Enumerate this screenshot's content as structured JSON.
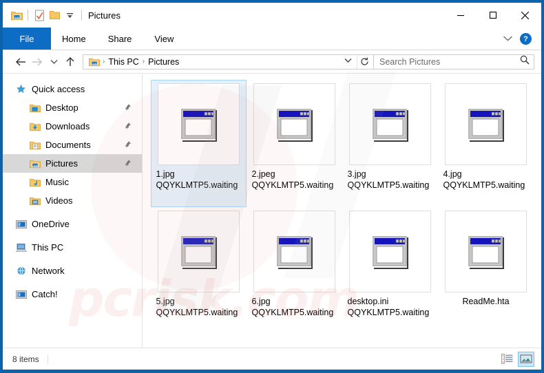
{
  "window": {
    "title": "Pictures",
    "accent_color": "#0b63ac",
    "quick_access": [
      {
        "name": "pictures-folder-icon",
        "label": "Pictures"
      },
      {
        "name": "properties-icon",
        "label": "Properties"
      },
      {
        "name": "new-folder-icon",
        "label": "New folder"
      },
      {
        "name": "customize-chevron-icon",
        "label": "Customize Quick Access Toolbar"
      }
    ],
    "controls": {
      "minimize": "—",
      "maximize": "❑",
      "close": "✕"
    }
  },
  "ribbon": {
    "tabs": [
      {
        "label": "File",
        "active": true
      },
      {
        "label": "Home",
        "active": false
      },
      {
        "label": "Share",
        "active": false
      },
      {
        "label": "View",
        "active": false
      }
    ],
    "collapse_chevron": "⌄",
    "help_label": "?"
  },
  "address_bar": {
    "back": "←",
    "forward": "→",
    "recent": "∨",
    "up": "↑",
    "breadcrumb": [
      "This PC",
      "Pictures"
    ],
    "separator": "›",
    "dropdown_chevron": "∨",
    "refresh": "↻"
  },
  "search": {
    "placeholder": "Search Pictures",
    "value": "",
    "icon": "search-icon"
  },
  "sidebar": {
    "items": [
      {
        "label": "Quick access",
        "icon": "star-icon",
        "indent": false,
        "selected": false,
        "pinned": false
      },
      {
        "label": "Desktop",
        "icon": "desktop-folder-icon",
        "indent": true,
        "selected": false,
        "pinned": true
      },
      {
        "label": "Downloads",
        "icon": "downloads-folder-icon",
        "indent": true,
        "selected": false,
        "pinned": true
      },
      {
        "label": "Documents",
        "icon": "documents-folder-icon",
        "indent": true,
        "selected": false,
        "pinned": true
      },
      {
        "label": "Pictures",
        "icon": "pictures-folder-icon",
        "indent": true,
        "selected": true,
        "pinned": true
      },
      {
        "label": "Music",
        "icon": "music-folder-icon",
        "indent": true,
        "selected": false,
        "pinned": false
      },
      {
        "label": "Videos",
        "icon": "videos-folder-icon",
        "indent": true,
        "selected": false,
        "pinned": false
      },
      {
        "label": "OneDrive",
        "icon": "onedrive-icon",
        "indent": false,
        "selected": false,
        "pinned": false
      },
      {
        "label": "This PC",
        "icon": "this-pc-icon",
        "indent": false,
        "selected": false,
        "pinned": false
      },
      {
        "label": "Network",
        "icon": "network-icon",
        "indent": false,
        "selected": false,
        "pinned": false
      },
      {
        "label": "Catch!",
        "icon": "catch-icon",
        "indent": false,
        "selected": false,
        "pinned": false
      }
    ]
  },
  "files": [
    {
      "name": "1.jpg",
      "suffix": "QQYKLMTP5.waiting",
      "selected": true,
      "icon": "unknown-file-icon"
    },
    {
      "name": "2.jpeg",
      "suffix": "QQYKLMTP5.waiting",
      "selected": false,
      "icon": "unknown-file-icon"
    },
    {
      "name": "3.jpg",
      "suffix": "QQYKLMTP5.waiting",
      "selected": false,
      "icon": "unknown-file-icon"
    },
    {
      "name": "4.jpg",
      "suffix": "QQYKLMTP5.waiting",
      "selected": false,
      "icon": "unknown-file-icon"
    },
    {
      "name": "5.jpg",
      "suffix": "QQYKLMTP5.waiting",
      "selected": false,
      "icon": "unknown-file-icon"
    },
    {
      "name": "6.jpg",
      "suffix": "QQYKLMTP5.waiting",
      "selected": false,
      "icon": "unknown-file-icon"
    },
    {
      "name": "desktop.ini",
      "suffix": "QQYKLMTP5.waiting",
      "selected": false,
      "icon": "unknown-file-icon"
    },
    {
      "name": "ReadMe.hta",
      "suffix": "",
      "selected": false,
      "icon": "unknown-file-icon"
    }
  ],
  "status_bar": {
    "item_count": "8 items",
    "views": [
      {
        "name": "details-view-icon",
        "active": false
      },
      {
        "name": "large-icons-view-icon",
        "active": true
      }
    ]
  },
  "watermark": {
    "text": "pcrisk.com"
  }
}
